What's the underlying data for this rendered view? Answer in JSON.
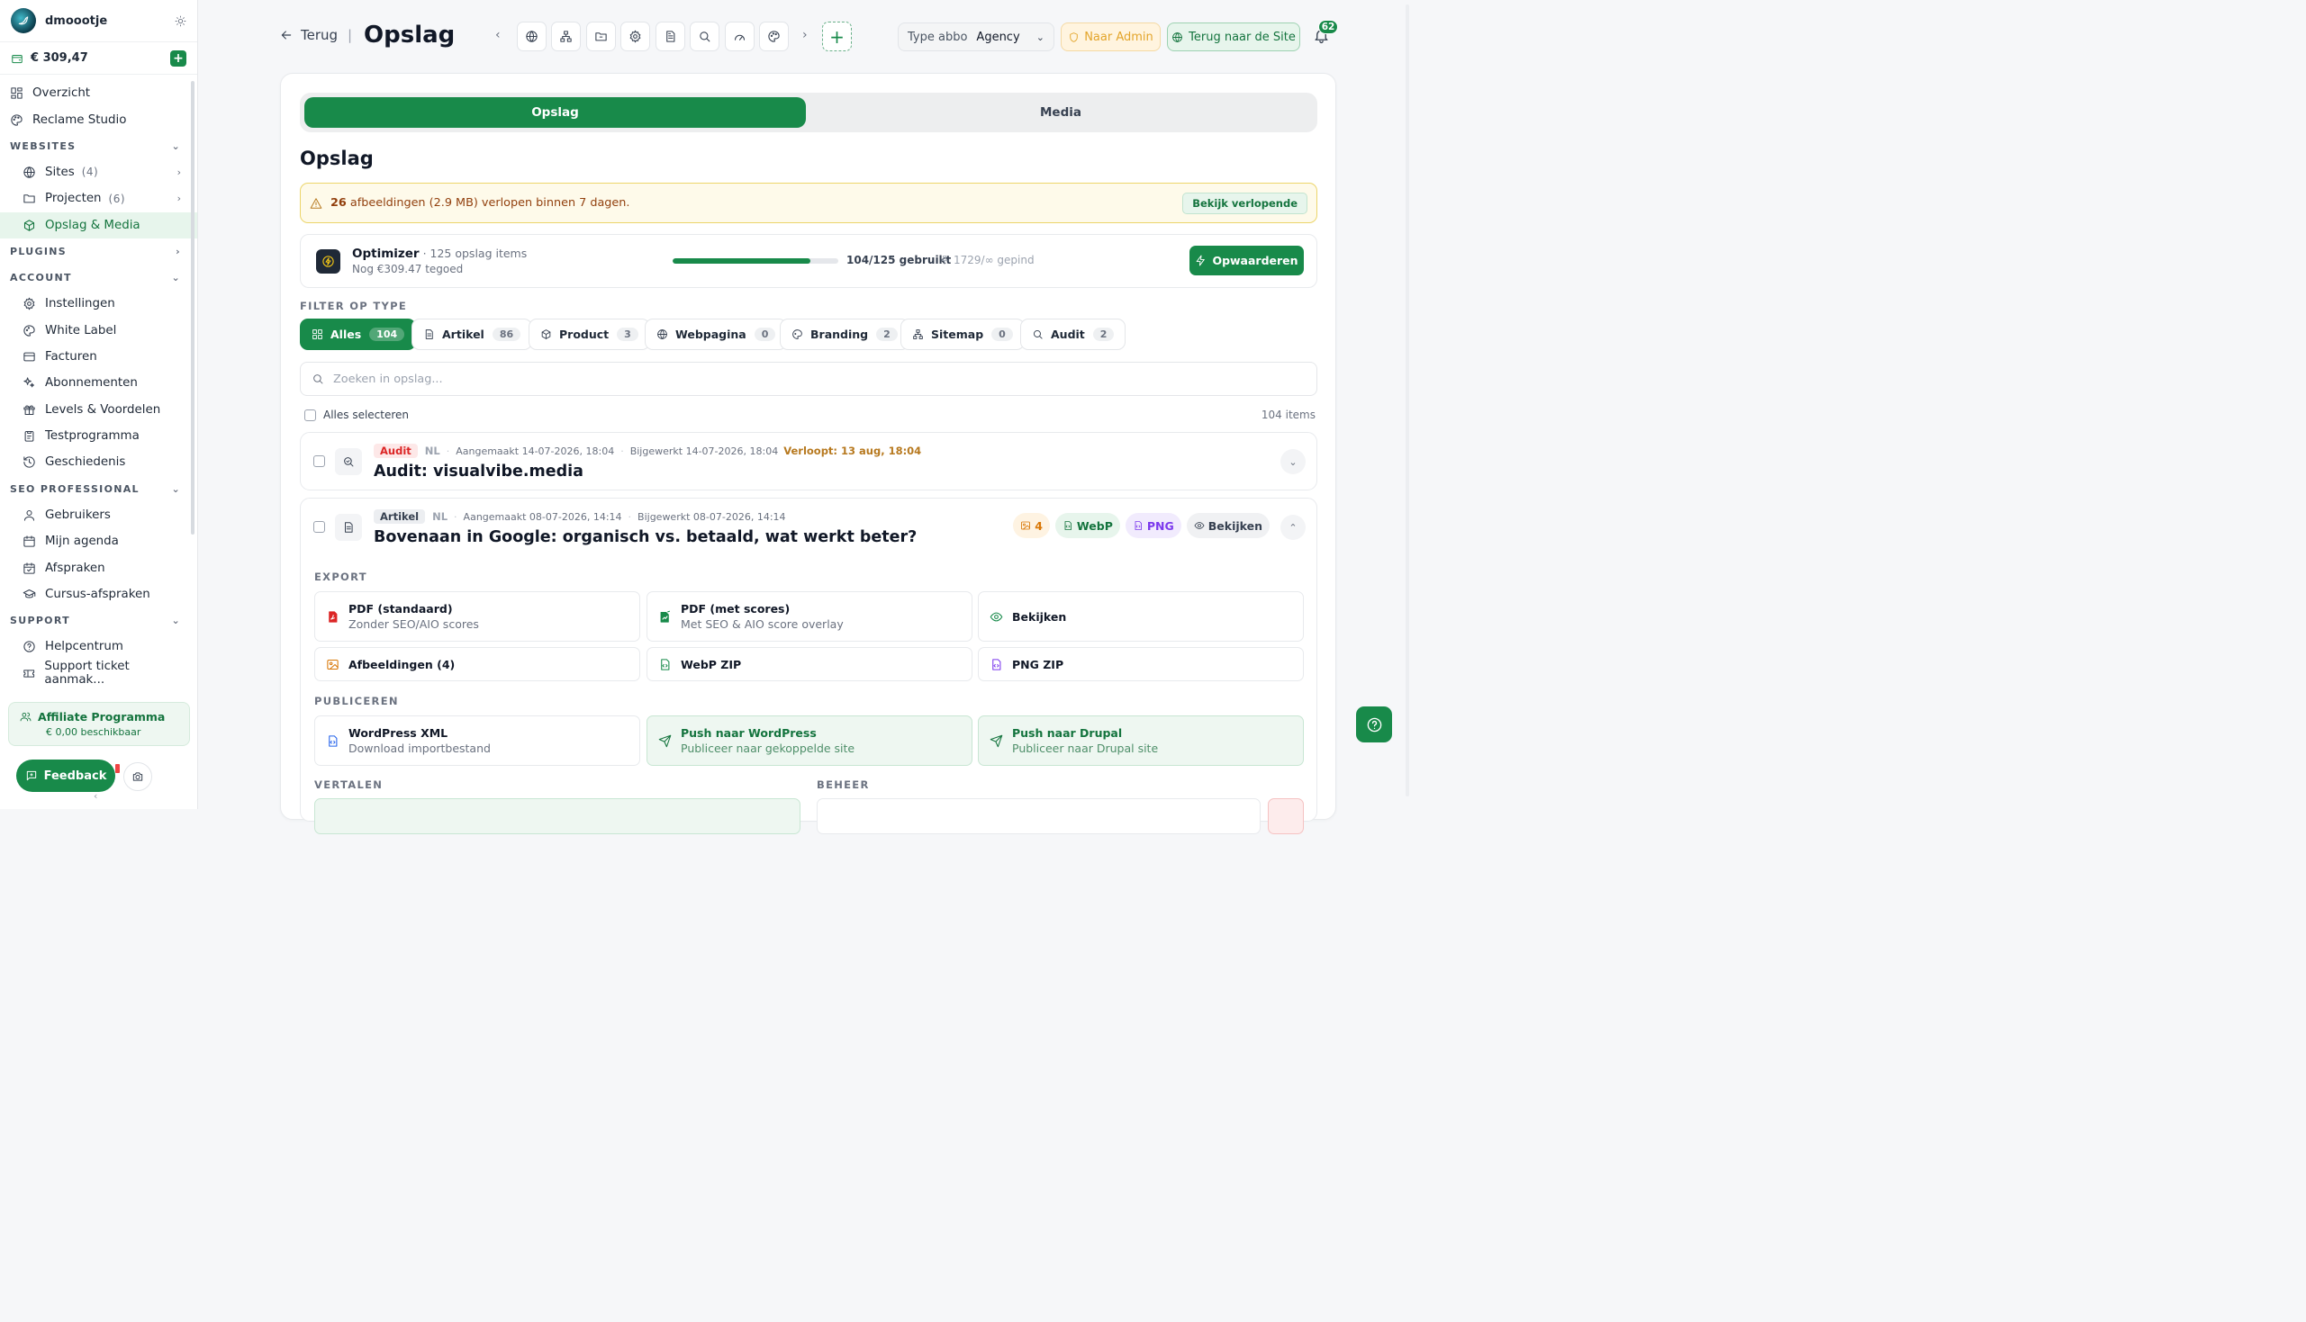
{
  "sidebar": {
    "username": "dmoootje",
    "balance": "€ 309,47",
    "items": {
      "overzicht": "Overzicht",
      "reclame": "Reclame Studio",
      "sites": "Sites",
      "sites_count": "(4)",
      "projecten": "Projecten",
      "projecten_count": "(6)",
      "opslag": "Opslag & Media",
      "instellingen": "Instellingen",
      "whitelabel": "White Label",
      "facturen": "Facturen",
      "abonnementen": "Abonnementen",
      "levels": "Levels & Voordelen",
      "testprogramma": "Testprogramma",
      "geschiedenis": "Geschiedenis",
      "gebruikers": "Gebruikers",
      "agenda": "Mijn agenda",
      "afspraken": "Afspraken",
      "cursus": "Cursus-afspraken",
      "helpcentrum": "Helpcentrum",
      "ticket": "Support ticket aanmak..."
    },
    "sections": {
      "websites": "WEBSITES",
      "plugins": "PLUGINS",
      "account": "ACCOUNT",
      "seo": "SEO PROFESSIONAL",
      "support": "SUPPORT"
    },
    "affiliate": {
      "title": "Affiliate Programma",
      "sub": "€ 0,00 beschikbaar"
    },
    "feedback": "Feedback"
  },
  "header": {
    "back": "Terug",
    "separator": "|",
    "title": "Opslag",
    "abbo_label": "Type abbo",
    "abbo_value": "Agency",
    "admin": "Naar Admin",
    "site": "Terug naar de Site",
    "notifications": "62"
  },
  "main": {
    "tabs": {
      "opslag": "Opslag",
      "media": "Media"
    },
    "heading": "Opslag",
    "alert": {
      "count": "26",
      "text": " afbeeldingen (2.9 MB) verlopen binnen 7 dagen.",
      "action": "Bekijk verlopende"
    },
    "optimizer": {
      "name": "Optimizer",
      "meta": " · 125 opslag items",
      "sub": "Nog €309.47 tegoed",
      "usage_fraction": 0.832,
      "usage_label": "104/125 gebruikt",
      "pinned_label": "1729/∞ gepind",
      "upgrade": "Opwaarderen"
    },
    "filter_label": "FILTER OP TYPE",
    "filters": [
      {
        "label": "Alles",
        "count": "104"
      },
      {
        "label": "Artikel",
        "count": "86"
      },
      {
        "label": "Product",
        "count": "3"
      },
      {
        "label": "Webpagina",
        "count": "0"
      },
      {
        "label": "Branding",
        "count": "2"
      },
      {
        "label": "Sitemap",
        "count": "0"
      },
      {
        "label": "Audit",
        "count": "2"
      }
    ],
    "search_placeholder": "Zoeken in opslag...",
    "select_all": "Alles selecteren",
    "items_count": "104 items",
    "rows": [
      {
        "type": "Audit",
        "lang": "NL",
        "created": "Aangemaakt 14-07-2026, 18:04",
        "updated": "Bijgewerkt 14-07-2026, 18:04",
        "expires": "Verloopt: 13 aug, 18:04",
        "title": "Audit: visualvibe.media"
      },
      {
        "type": "Artikel",
        "lang": "NL",
        "created": "Aangemaakt 08-07-2026, 14:14",
        "updated": "Bijgewerkt 08-07-2026, 14:14",
        "title": "Bovenaan in Google: organisch vs. betaald, wat werkt beter?",
        "pills": {
          "images": "4",
          "webp": "WebP",
          "png": "PNG",
          "view": "Bekijken"
        }
      }
    ],
    "sections": {
      "export": "EXPORT",
      "publiceren": "PUBLICEREN",
      "vertalen": "VERTALEN",
      "beheer": "BEHEER"
    },
    "export": {
      "pdf_std_t": "PDF (standaard)",
      "pdf_std_s": "Zonder SEO/AIO scores",
      "pdf_sc_t": "PDF (met scores)",
      "pdf_sc_s": "Met SEO & AIO score overlay",
      "view": "Bekijken",
      "images": "Afbeeldingen (4)",
      "webp": "WebP ZIP",
      "png": "PNG ZIP"
    },
    "publish": {
      "wpxml_t": "WordPress XML",
      "wpxml_s": "Download importbestand",
      "wp_t": "Push naar WordPress",
      "wp_s": "Publiceer naar gekoppelde site",
      "drupal_t": "Push naar Drupal",
      "drupal_s": "Publiceer naar Drupal site"
    }
  },
  "colors": {
    "brand": "#188a4a",
    "alert": "#fefaea",
    "danger": "#dc2626"
  }
}
